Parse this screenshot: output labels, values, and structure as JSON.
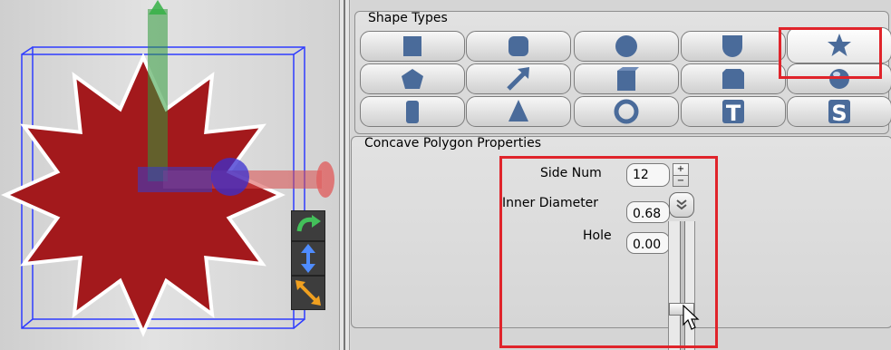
{
  "shape_types": {
    "title": "Shape Types",
    "rows": [
      [
        "cube-icon",
        "rounded-cube-icon",
        "sphere-icon",
        "half-cylinder-icon",
        "star-icon"
      ],
      [
        "pentagon-icon",
        "arrow-icon",
        "box-icon",
        "chamfer-box-icon",
        "ball-icon"
      ],
      [
        "cylinder-icon",
        "cone-icon",
        "torus-icon",
        "text-t-icon",
        "text-s-icon"
      ]
    ],
    "selected": "star-icon",
    "text_t": "T",
    "text_s": "S"
  },
  "properties": {
    "title": "Concave Polygon Properties",
    "side_num_label": "Side Num",
    "side_num_value": "12",
    "inner_diameter_label": "Inner Diameter",
    "inner_diameter_value": "0.68",
    "hole_label": "Hole",
    "hole_value": "0.00"
  },
  "colors": {
    "highlight": "#e0242b",
    "button_shape": "#4a6b9a",
    "star_fill": "#a3191c"
  }
}
